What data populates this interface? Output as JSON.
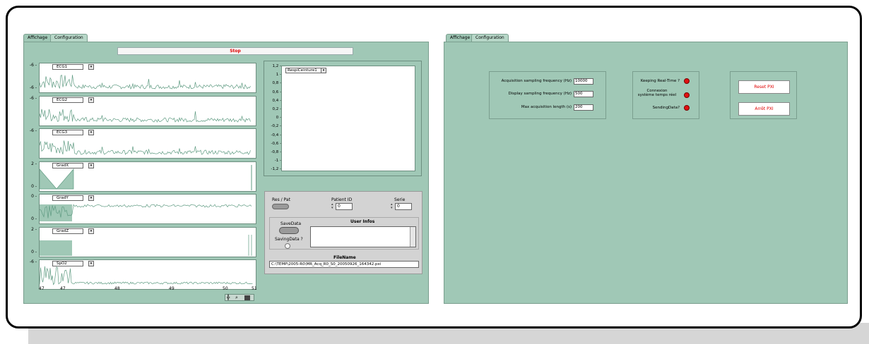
{
  "left_panel": {
    "tabs": [
      "Affichage",
      "Configuration"
    ],
    "stop_button": "Stop",
    "strips": [
      {
        "name": "ECG1",
        "ticks": [
          "-6 -",
          "-6 -"
        ]
      },
      {
        "name": "ECG2",
        "ticks": [
          "-6 -"
        ]
      },
      {
        "name": "ECG3",
        "ticks": [
          "-6 -"
        ]
      },
      {
        "name": "GradX",
        "ticks": [
          "2 -",
          "0 -"
        ]
      },
      {
        "name": "GradY",
        "ticks": [
          "0 -",
          "0 -"
        ]
      },
      {
        "name": "GradZ",
        "ticks": [
          "2 -",
          "0 -"
        ]
      },
      {
        "name": "SpO2",
        "ticks": [
          "-6 -"
        ]
      }
    ],
    "x_ticks": [
      "47",
      "47",
      "48",
      "49",
      "50",
      "51"
    ],
    "resp_chart": {
      "channel": "RespiCeinture1",
      "y_ticks": [
        "1,2",
        "1",
        "0,8",
        "0,6",
        "0,4",
        "0,2",
        "0",
        "-0,2",
        "-0,4",
        "-0,6",
        "-0,8",
        "-1",
        "-1,2"
      ]
    },
    "controls": {
      "res_pat": "Res / Pat",
      "patient_id_label": "Patient ID",
      "patient_id_value": "0",
      "serie_label": "Serie",
      "serie_value": "0",
      "save_data": "SaveData",
      "saving_data": "SavingData ?",
      "user_infos": "User Infos",
      "filename_label": "FileName",
      "filename_value": "C:\\TEMP\\2005-R0\\MR_Acq_R0_S0_20050926_164342.pxi"
    }
  },
  "right_panel": {
    "tabs": [
      "Affichage",
      "Configuration"
    ],
    "acq_freq_label": "Acquisition sampling frequency (Hz)",
    "acq_freq_value": "10000",
    "disp_freq_label": "Display sampling frequency (Hz)",
    "disp_freq_value": "500",
    "max_len_label": "Max acquisition length (s)",
    "max_len_value": "200",
    "keeping_rt": "Keeping Real-Time ?",
    "connexion_line1": "Connexion",
    "connexion_line2": "système temps réel",
    "sending_data": "SendingData?",
    "reset_button": "Reset PXI",
    "stop_button": "Arrêt PXI"
  },
  "colors": {
    "panel": "#a0c8b6",
    "led": "#e01010",
    "button_text": "#e00000"
  }
}
